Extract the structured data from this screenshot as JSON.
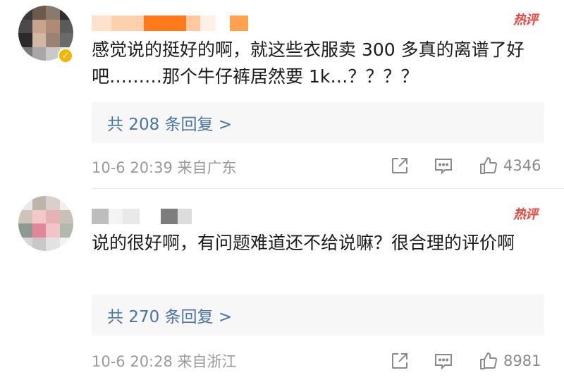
{
  "comments": [
    {
      "hot_label": "热评",
      "text": "感觉说的挺好的啊，就这些衣服卖 300 多真的离谱了好吧………那个牛仔裤居然要 1k…？？？？",
      "replies_label": "共 208 条回复 >",
      "timestamp": "10-6 20:39 来自广东",
      "like_count": "4346",
      "verified": true
    },
    {
      "hot_label": "热评",
      "text": "说的很好啊，有问题难道还不给说嘛？很合理的评价啊",
      "replies_label": "共 270 条回复 >",
      "timestamp": "10-6 20:28 来自浙江",
      "like_count": "8981",
      "verified": false
    }
  ],
  "colors": {
    "link": "#4a73a8",
    "hot": "#f0443a",
    "meta": "#9a9a9a",
    "reply_bg": "#f7f7f7",
    "verified_badge": "#f5b400"
  },
  "icons": [
    "share-icon",
    "comment-icon",
    "like-icon",
    "verified-badge-icon"
  ]
}
